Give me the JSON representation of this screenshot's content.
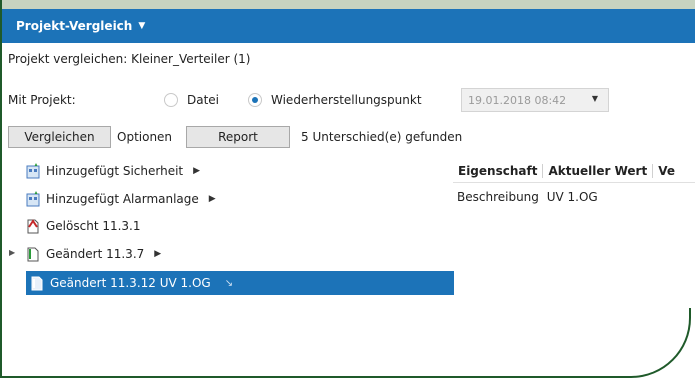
{
  "panel": {
    "title": "Projekt-Vergleich"
  },
  "compare_line": "Projekt vergleichen: Kleiner_Verteiler (1)",
  "mit_projekt": {
    "label": "Mit Projekt:",
    "option_file": "Datei",
    "option_restore": "Wiederherstellungspunkt",
    "selected": "Wiederherstellungspunkt",
    "date_value": "19.01.2018 08:42"
  },
  "toolbar": {
    "compare_label": "Vergleichen",
    "options_label": "Optionen",
    "report_label": "Report",
    "result_text": "5 Unterschied(e) gefunden"
  },
  "tree": [
    {
      "label": "Hinzugefügt Sicherheit",
      "has_arrow": true
    },
    {
      "label": "Hinzugefügt Alarmanlage",
      "has_arrow": true
    },
    {
      "label": "Gelöscht 11.3.1",
      "has_arrow": false
    },
    {
      "label": "Geändert 11.3.7",
      "has_arrow": true
    },
    {
      "label": "Geändert 11.3.12 UV 1.OG",
      "has_arrow": false,
      "selected": true
    }
  ],
  "properties": {
    "headers": [
      "Eigenschaft",
      "Aktueller Wert",
      "Ve"
    ],
    "row": {
      "property": "Beschreibung",
      "value": "UV 1.OG"
    }
  },
  "colors": {
    "accent": "#1c73b8",
    "frame": "#1f5a2a"
  }
}
